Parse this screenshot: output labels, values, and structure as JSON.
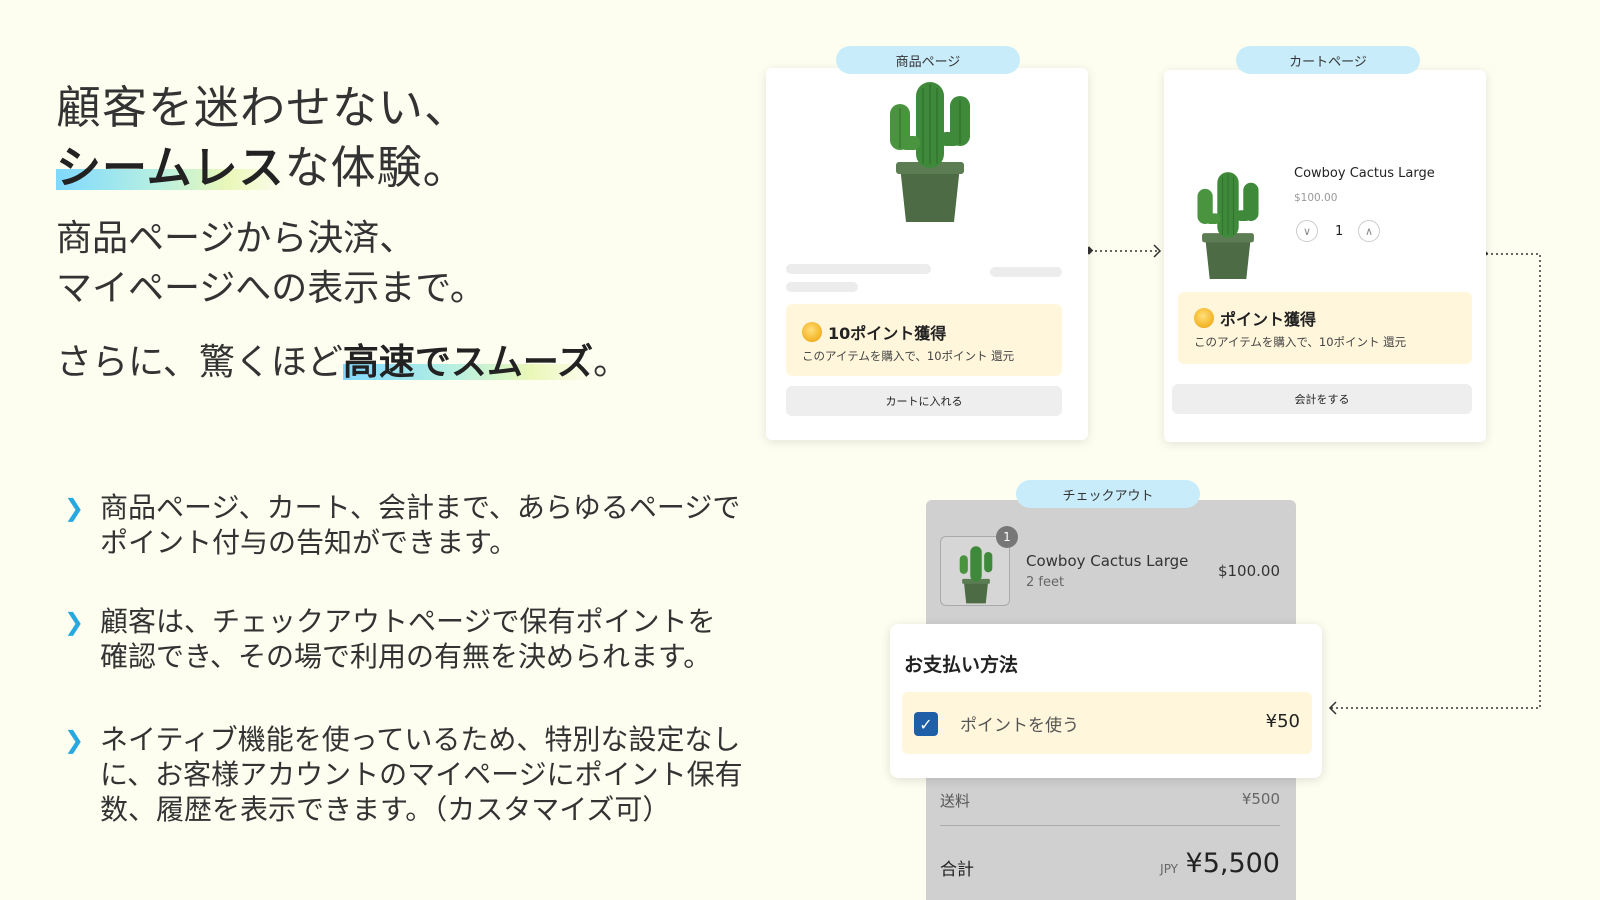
{
  "headline": {
    "line1": "顧客を迷わせない、",
    "line2_highlight": "シームレス",
    "line2_rest": "な体験。"
  },
  "subtext": {
    "line1": "商品ページから決済、",
    "line2": "マイページへの表示まで。",
    "line3_prefix": "さらに、驚くほど",
    "line3_highlight": "高速でスムーズ",
    "line3_suffix": "。"
  },
  "bullets": [
    {
      "icon": "chevron-right-icon",
      "line1": "商品ページ、カート、会計まで、あらゆるページで",
      "line2": "ポイント付与の告知ができます。",
      "line3": ""
    },
    {
      "icon": "chevron-right-icon",
      "line1": "顧客は、チェックアウトページで保有ポイントを",
      "line2": "確認でき、その場で利用の有無を決められます。",
      "line3": ""
    },
    {
      "icon": "chevron-right-icon",
      "line1": "ネイティブ機能を使っているため、特別な設定なし",
      "line2": "に、お客様アカウントのマイページにポイント保有",
      "line3": "数、履歴を表示できます。（カスタマイズ可）"
    }
  ],
  "product_page": {
    "tag": "商品ページ",
    "points_title": "10ポイント獲得",
    "points_desc": "このアイテムを購入で、10ポイント 還元",
    "button": "カートに入れる"
  },
  "cart_page": {
    "tag": "カートページ",
    "item_name": "Cowboy Cactus Large",
    "item_price": "$100.00",
    "quantity": "1",
    "points_title": "ポイント獲得",
    "points_desc": "このアイテムを購入で、10ポイント 還元",
    "button": "会計をする"
  },
  "checkout": {
    "tag": "チェックアウト",
    "badge": "1",
    "item_name": "Cowboy Cactus Large",
    "item_variant": "2 feet",
    "item_price": "$100.00",
    "payment_title": "お支払い方法",
    "use_points_label": "ポイントを使う",
    "use_points_checked": true,
    "use_points_amount": "¥50",
    "shipping_label": "送料",
    "shipping_value": "¥500",
    "total_label": "合計",
    "currency": "JPY",
    "total_value": "¥5,500"
  },
  "colors": {
    "background": "#fdfdf0",
    "accent_blue": "#29a8e0",
    "tag_bg": "#c8ecfa",
    "points_bg": "#fff6dc",
    "checkbox": "#1f5fa8"
  }
}
